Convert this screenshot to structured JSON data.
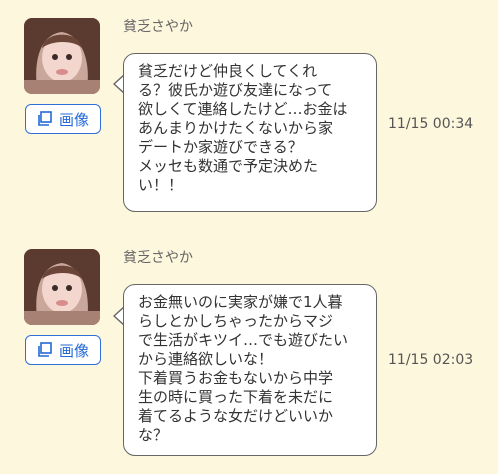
{
  "messages": [
    {
      "sender": "貧乏さやか",
      "image_button_label": "画像",
      "text": "貧乏だけど仲良くしてくれ\nる？彼氏か遊び友達になって\n欲しくて連絡したけど…お金は\nあんまりかけたくないから家\nデートか家遊びできる？\nメッセも数通で予定決めた\nい！！",
      "time": "11/15 00:34"
    },
    {
      "sender": "貧乏さやか",
      "image_button_label": "画像",
      "text": "お金無いのに実家が嫌で1人暮\nらしとかしちゃったからマジ\nで生活がキツイ…でも遊びたい\nから連絡欲しいな！\n下着買うお金もないから中学\n生の時に買った下着を未だに\n着てるような女だけどいいか\nな？",
      "time": "11/15 02:03"
    }
  ],
  "colors": {
    "background": "#fdf7dd",
    "accent": "#2468d6",
    "bubble": "#ffffff"
  }
}
